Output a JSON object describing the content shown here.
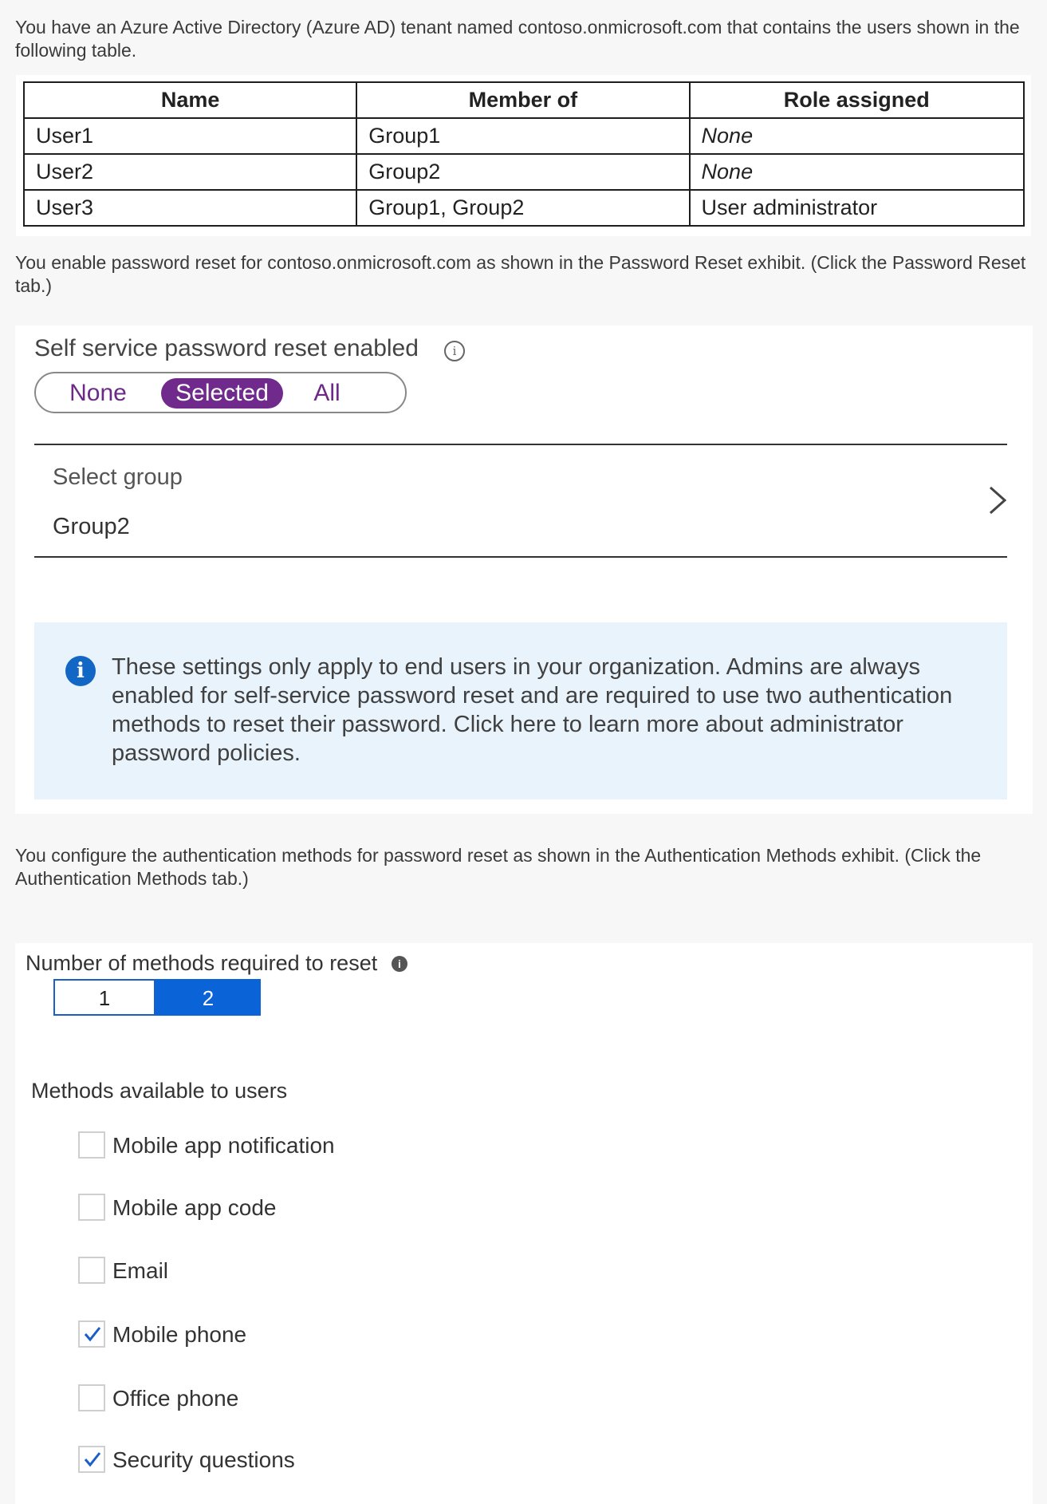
{
  "intro": {
    "p1": "You have an Azure Active Directory (Azure AD) tenant named contoso.onmicrosoft.com that contains the users shown in the following table.",
    "p2": "You enable password reset for contoso.onmicrosoft.com as shown in the Password Reset exhibit. (Click the Password Reset tab.)",
    "p3": "You configure the authentication methods for password reset as shown in the Authentication Methods exhibit. (Click the Authentication Methods tab.)"
  },
  "users_table": {
    "headers": [
      "Name",
      "Member of",
      "Role assigned"
    ],
    "rows": [
      [
        "User1",
        "Group1",
        "None"
      ],
      [
        "User2",
        "Group2",
        "None"
      ],
      [
        "User3",
        "Group1, Group2",
        "User administrator"
      ]
    ]
  },
  "password_reset": {
    "label": "Self service password reset enabled",
    "info_icon": "info-outline-icon",
    "options": [
      "None",
      "Selected",
      "All"
    ],
    "selected_option": "Selected",
    "select_group_label": "Select group",
    "select_group_value": "Group2",
    "info_text": "These settings only apply to end users in your organization. Admins are always enabled for self-service password reset and are required to use two authentication methods to reset their password. Click here to learn more about administrator password policies.",
    "accent_color": "#6f2a8c"
  },
  "auth_methods": {
    "num_label": "Number of methods required to reset",
    "num_options": [
      "1",
      "2"
    ],
    "num_selected": "2",
    "methods_label": "Methods available to users",
    "methods": [
      {
        "label": "Mobile app notification",
        "checked": false
      },
      {
        "label": "Mobile app code",
        "checked": false
      },
      {
        "label": "Email",
        "checked": false
      },
      {
        "label": "Mobile phone",
        "checked": true
      },
      {
        "label": "Office phone",
        "checked": false
      },
      {
        "label": "Security questions",
        "checked": true
      }
    ],
    "accent_color": "#0b63d8"
  }
}
